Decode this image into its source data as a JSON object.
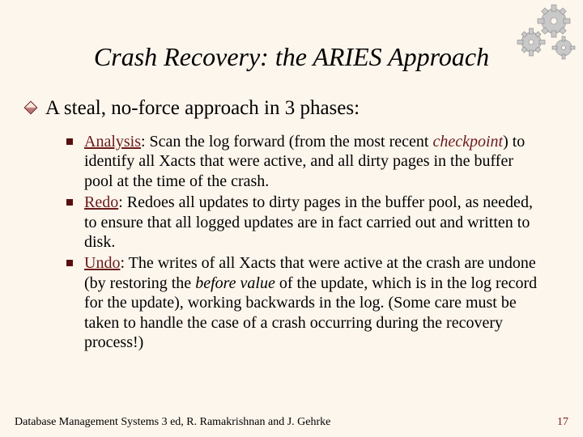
{
  "title": "Crash Recovery: the ARIES Approach",
  "intro": "A steal, no-force approach in 3 phases:",
  "phases": {
    "analysis": {
      "name": "Analysis",
      "lead": ":  Scan the log forward (from the most recent ",
      "checkpoint": "checkpoint",
      "tail": ") to identify all Xacts that were active, and all dirty pages in the buffer pool at the time of the crash."
    },
    "redo": {
      "name": "Redo",
      "body": ":  Redoes all updates to dirty pages in the buffer pool, as needed, to ensure that all logged updates are in fact carried out and written to disk."
    },
    "undo": {
      "name": "Undo",
      "lead": ":  The  writes of all Xacts that were active at the crash are undone (by restoring the ",
      "before": "before value",
      "tail": " of the update, which is in the log record for the update), working backwards in the log.  (Some care must be taken to handle the case of a crash occurring during the recovery process!)"
    }
  },
  "footer": {
    "source": "Database Management Systems 3 ed,  R. Ramakrishnan and J. Gehrke",
    "page": "17"
  }
}
